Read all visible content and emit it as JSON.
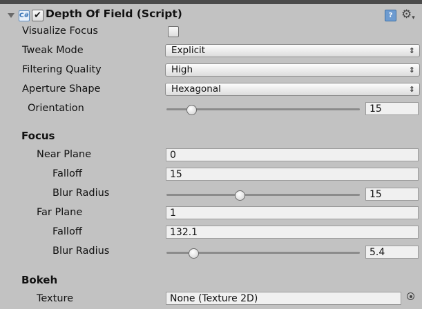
{
  "component": {
    "title": "Depth Of Field (Script)",
    "enabled": true,
    "foldout_open": true,
    "script_icon_glyph": "C#",
    "help_glyph": "?",
    "gear_glyph": "⚙"
  },
  "properties": {
    "visualize_focus": {
      "label": "Visualize Focus",
      "checked": false
    },
    "tweak_mode": {
      "label": "Tweak Mode",
      "value": "Explicit"
    },
    "filtering_quality": {
      "label": "Filtering Quality",
      "value": "High"
    },
    "aperture_shape": {
      "label": "Aperture Shape",
      "value": "Hexagonal"
    },
    "orientation": {
      "label": "Orientation",
      "value": "15",
      "slider_fraction": 0.13
    }
  },
  "focus": {
    "header": "Focus",
    "near_plane": {
      "label": "Near Plane",
      "value": "0"
    },
    "near_falloff": {
      "label": "Falloff",
      "value": "15"
    },
    "near_blur_radius": {
      "label": "Blur Radius",
      "value": "15",
      "slider_fraction": 0.38
    },
    "far_plane": {
      "label": "Far Plane",
      "value": "1"
    },
    "far_falloff": {
      "label": "Falloff",
      "value": "132.1"
    },
    "far_blur_radius": {
      "label": "Blur Radius",
      "value": "5.4",
      "slider_fraction": 0.14
    }
  },
  "bokeh": {
    "header": "Bokeh",
    "texture": {
      "label": "Texture",
      "value": "None (Texture 2D)"
    }
  },
  "popup_arrow_glyph": "⇕"
}
